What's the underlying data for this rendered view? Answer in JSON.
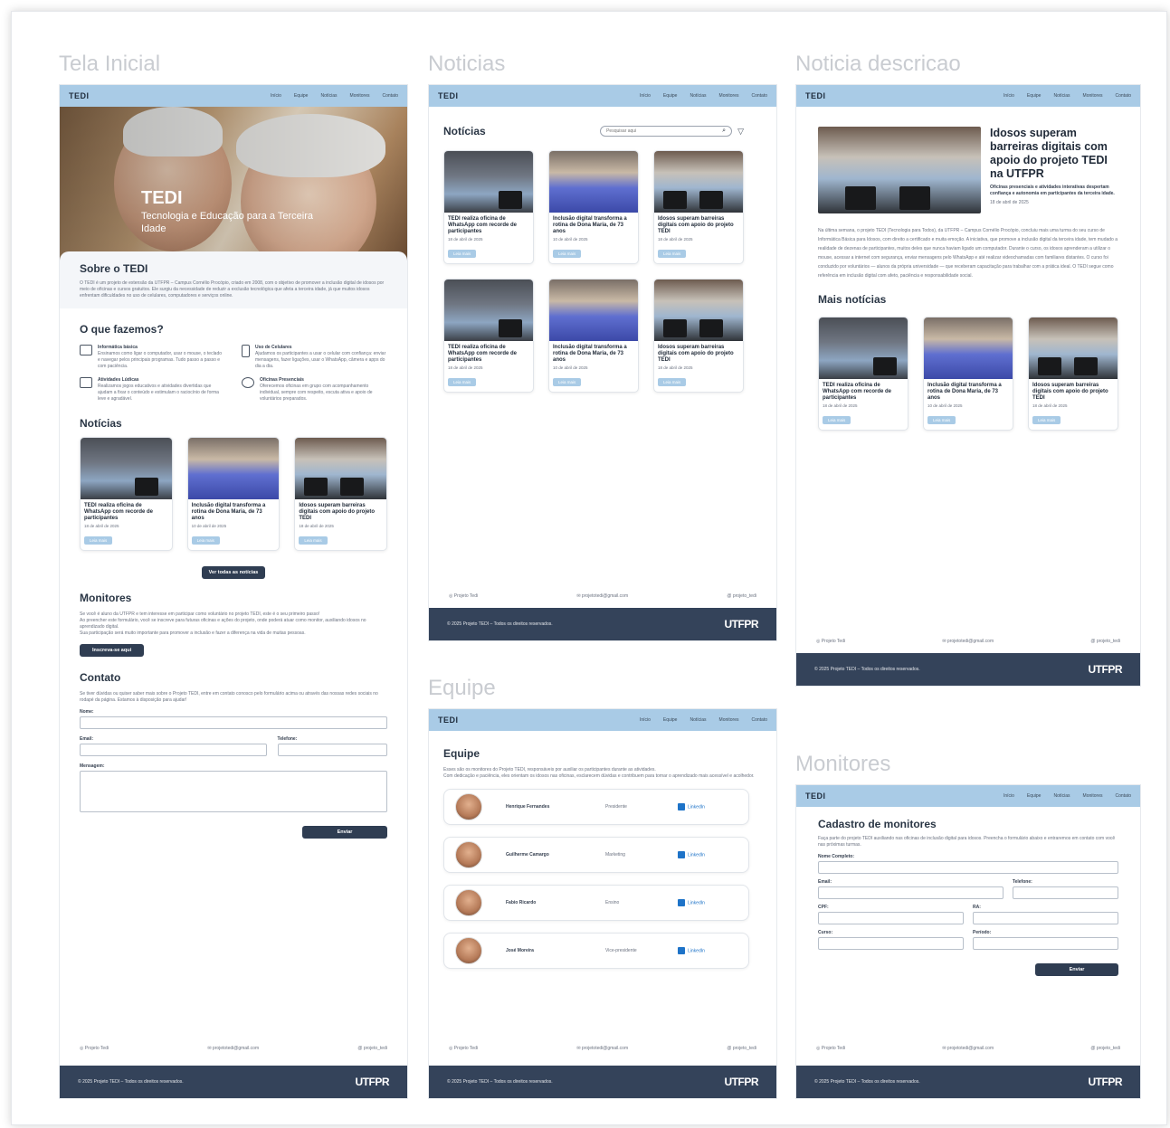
{
  "frames": {
    "tela_inicial": "Tela Inicial",
    "noticias": "Noticias",
    "noticia_descricao": "Noticia descricao",
    "equipe": "Equipe",
    "monitores": "Monitores"
  },
  "topbar": {
    "logo": "TEDI",
    "nav": [
      "Início",
      "Equipe",
      "Notícias",
      "Monitores",
      "Contato"
    ]
  },
  "home": {
    "hero_title": "TEDI",
    "hero_subtitle": "Tecnologia e Educação para a Terceira Idade",
    "about_title": "Sobre o TEDI",
    "about_text": "O TEDI é um projeto de extensão da UTFPR – Campus Cornélio Procópio, criado em 2008, com o objetivo de promover a inclusão digital de idosos por meio de oficinas e cursos gratuitos. Ele surgiu da necessidade de reduzir a exclusão tecnológica que afeta a terceira idade, já que muitos idosos enfrentam dificuldades no uso de celulares, computadores e serviços online.",
    "what_title": "O que fazemos?",
    "features": [
      {
        "title": "Informática básica",
        "text": "Ensinamos como ligar o computador, usar o mouse, o teclado e navegar pelos principais programas. Tudo passo a passo e com paciência."
      },
      {
        "title": "Uso de Celulares",
        "text": "Ajudamos os participantes a usar o celular com confiança: enviar mensagens, fazer ligações, usar o WhatsApp, câmera e apps do dia a dia."
      },
      {
        "title": "Atividades Lúdicas",
        "text": "Realizamos jogos educativos e atividades divertidas que ajudam a fixar o conteúdo e estimulam o raciocínio de forma leve e agradável."
      },
      {
        "title": "Oficinas Presenciais",
        "text": "Oferecemos oficinas em grupo com acompanhamento individual, sempre com respeito, escuta ativa e apoio de voluntários preparados."
      }
    ],
    "news_title": "Notícias",
    "all_news_button": "Ver todas as notícias",
    "monitors_title": "Monitores",
    "monitors_text_1": "Se você é aluno da UTFPR e tem interesse em participar como voluntário no projeto TEDI, este é o seu primeiro passo!",
    "monitors_text_2": "Ao preencher este formulário, você se inscreve para futuras oficinas e ações do projeto, onde poderá atuar como monitor, auxiliando idosos no aprendizado digital.",
    "monitors_text_3": "Sua participação será muito importante para promover a inclusão e fazer a diferença na vida de muitas pessoas.",
    "signup_button": "Inscreva-se aqui",
    "contact_title": "Contato",
    "contact_text": "Se tiver dúvidas ou quiser saber mais sobre o Projeto TEDI, entre em contato conosco pelo formulário acima ou através das nossas redes sociais no rodapé da página. Estamos à disposição para ajudar!",
    "labels": {
      "name": "Nome:",
      "email": "Email:",
      "phone": "Telefone:",
      "message": "Mensagem:"
    },
    "send_button": "Enviar"
  },
  "news_cards": [
    {
      "title": "TEDI realiza oficina de WhatsApp com recorde de participantes",
      "date": "18 de abril de 2025",
      "button": "Leia mais",
      "style": "ph1"
    },
    {
      "title": "Inclusão digital transforma a rotina de Dona Maria, de 73 anos",
      "date": "10 de abril de 2025",
      "button": "Leia mais",
      "style": "ph2"
    },
    {
      "title": "Idosos superam barreiras digitais com apoio do projeto TEDI",
      "date": "18 de abril de 2025",
      "button": "Leia mais",
      "style": "ph3"
    }
  ],
  "news_page": {
    "title": "Notícias",
    "search_placeholder": "Pesquisar aqui"
  },
  "news_detail": {
    "title": "Idosos superam barreiras digitais com apoio do projeto TEDI na UTFPR",
    "lead": "Oficinas presenciais e atividades interativas despertam confiança e autonomia em participantes da terceira idade.",
    "date": "18 de abril de 2025",
    "body": "Na última semana, o projeto TEDI (Tecnologia para Todos), da UTFPR – Campus Cornélio Procópio, concluiu mais uma turma do seu curso de Informática Básica para Idosos, com direito a certificado e muita emoção. A iniciativa, que promove a inclusão digital da terceira idade, tem mudado a realidade de dezenas de participantes, muitos deles que nunca haviam ligado um computador. Durante o curso, os idosos aprenderam a utilizar o mouse, acessar a internet com segurança, enviar mensagens pelo WhatsApp e até realizar videochamadas com familiares distantes. O curso foi conduzido por voluntários — alunos da própria universidade — que receberam capacitação para trabalhar com a prática ideal. O TEDI segue como referência em inclusão digital com afeto, paciência e responsabilidade social.",
    "more_title": "Mais notícias"
  },
  "team": {
    "title": "Equipe",
    "text_1": "Esses são os monitores do Projeto TEDI, responsáveis por auxiliar os participantes durante as atividades.",
    "text_2": "Com dedicação e paciência, eles orientam os idosos nas oficinas, esclarecem dúvidas e contribuem para tornar o aprendizado mais acessível e acolhedor.",
    "linkedin_label": "LinkedIn",
    "members": [
      {
        "name": "Henrique Fernandes",
        "role": "Presidente"
      },
      {
        "name": "Guilherme Camargo",
        "role": "Marketing"
      },
      {
        "name": "Fabio Ricardo",
        "role": "Ensino"
      },
      {
        "name": "José Moreira",
        "role": "Vice-presidente"
      }
    ]
  },
  "monitor_form": {
    "title": "Cadastro de monitores",
    "text": "Faça parte do projeto TEDI auxiliando nas oficinas de inclusão digital para idosos. Preencha o formulário abaixo e entraremos em contato com você nas próximas turmas.",
    "labels": {
      "name": "Nome Completo:",
      "email": "Email:",
      "phone": "Telefone:",
      "cpf": "CPF:",
      "ra": "RA:",
      "course": "Curso:",
      "period": "Período:"
    },
    "send_button": "Enviar"
  },
  "footer": {
    "instagram": "Projeto Tedi",
    "email": "projetotedi@gmail.com",
    "handle": "projeto_tedi",
    "copyright": "© 2025 Projeto TEDI – Todos os direitos reservados.",
    "logo": "UTFPR"
  }
}
